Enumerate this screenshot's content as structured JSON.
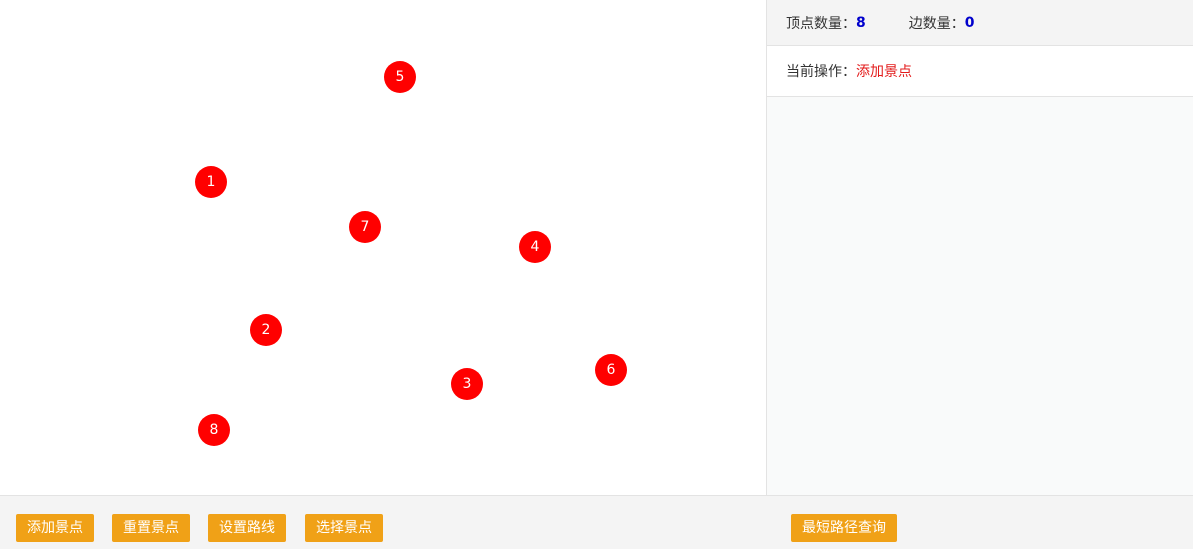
{
  "graph": {
    "nodes": [
      {
        "label": "5"
      },
      {
        "label": "1"
      },
      {
        "label": "7"
      },
      {
        "label": "4"
      },
      {
        "label": "2"
      },
      {
        "label": "3"
      },
      {
        "label": "6"
      },
      {
        "label": "8"
      }
    ],
    "node_color": "#ff0000"
  },
  "side_panel": {
    "vertex_count_label": "顶点数量：",
    "vertex_count": "8",
    "edge_count_label": "边数量：",
    "edge_count": "0",
    "current_op_label": "当前操作：",
    "current_op_value": "添加景点"
  },
  "toolbar": {
    "add_spot": "添加景点",
    "reset_spot": "重置景点",
    "set_route": "设置路线",
    "select_spot": "选择景点",
    "shortest_path": "最短路径查询"
  },
  "colors": {
    "accent_button": "#f0a117",
    "count_value": "#0000cc",
    "op_value": "#e31b1b"
  }
}
